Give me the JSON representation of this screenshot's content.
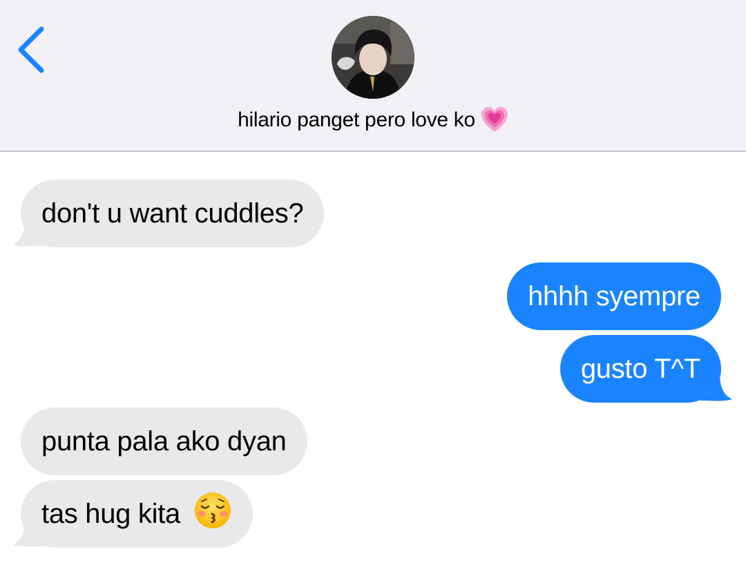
{
  "header": {
    "back_label": "Back",
    "contact_name": "hilario panget pero love ko",
    "contact_emoji": "growing-heart-emoji",
    "avatar": "contact-avatar-photo"
  },
  "messages": [
    {
      "direction": "received",
      "text": "don't u want cuddles?"
    },
    {
      "direction": "sent",
      "text": "hhhh syempre"
    },
    {
      "direction": "sent",
      "text": "gusto T^T"
    },
    {
      "direction": "received",
      "text": "punta pala ako dyan"
    },
    {
      "direction": "received",
      "text": "tas hug kita",
      "emoji": "kissing-face-with-closed-eyes-emoji"
    }
  ],
  "colors": {
    "header_bg": "#f2f1f6",
    "received_bubble": "#e9e9eb",
    "sent_bubble": "#1a84ff",
    "accent": "#1a84ff"
  }
}
